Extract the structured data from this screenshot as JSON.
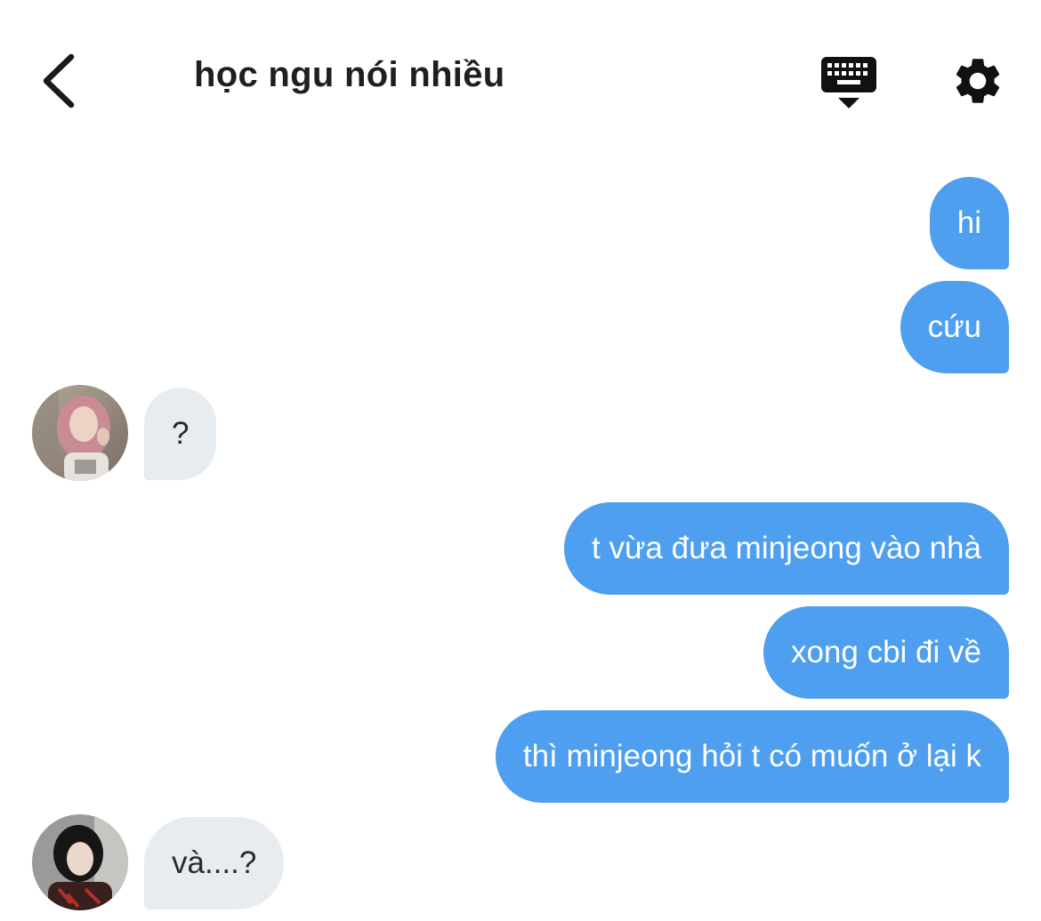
{
  "header": {
    "title": "học ngu nói nhiều",
    "back_icon": "chevron-left-icon",
    "keyboard_icon": "keyboard-hide-icon",
    "settings_icon": "gear-icon"
  },
  "colors": {
    "outgoing_bubble": "#4f9ff0",
    "incoming_bubble": "#e7ecf1",
    "text_dark": "#1f1f21"
  },
  "messages": [
    {
      "from": "me",
      "text": "hi"
    },
    {
      "from": "me",
      "text": "cứu"
    },
    {
      "from": "them",
      "text": "?"
    },
    {
      "from": "me",
      "text": "t vừa đưa minjeong vào nhà"
    },
    {
      "from": "me",
      "text": "xong cbi đi về"
    },
    {
      "from": "me",
      "text": "thì minjeong hỏi t có muốn ở lại k"
    },
    {
      "from": "them",
      "text": "và....?"
    }
  ]
}
